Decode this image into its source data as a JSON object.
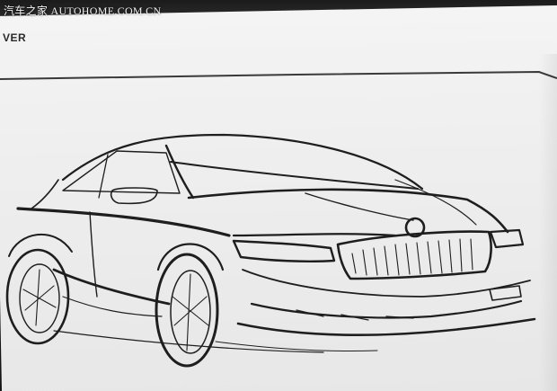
{
  "watermark": {
    "text": "汽车之家 AUTOHOME.COM.CN"
  },
  "slide": {
    "header_text": "VER"
  },
  "sketch": {
    "subject": "car-sketch",
    "line_color": "#1e1e1e"
  }
}
